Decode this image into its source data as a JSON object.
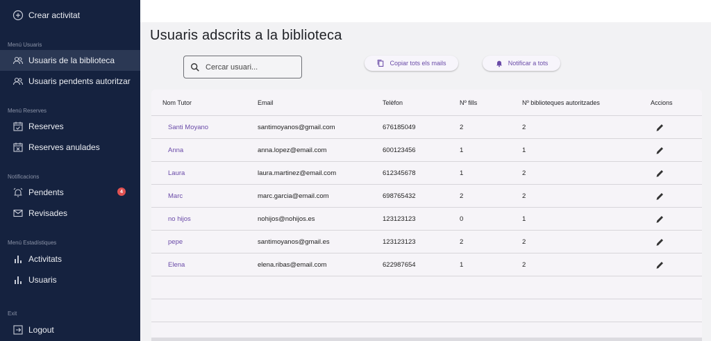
{
  "sidebar": {
    "create": "Crear activitat",
    "sections": {
      "users": "Menú Usuaris",
      "bookings": "Menú Reserves",
      "notifications": "Notificacions",
      "stats": "Menú Estadístiques",
      "exit": "Exit"
    },
    "items": {
      "library_users": "Usuaris de la biblioteca",
      "pending_users": "Usuaris pendents autoritzar",
      "bookings": "Reserves",
      "cancelled_bookings": "Reserves anulades",
      "pending": "Pendents",
      "pending_badge": "4",
      "reviewed": "Revisades",
      "activities": "Activitats",
      "stats_users": "Usuaris",
      "logout": "Logout"
    }
  },
  "main": {
    "title": "Usuaris adscrits a la biblioteca",
    "search_placeholder": "Cercar usuari...",
    "copy_button": "Copiar tots els mails",
    "notify_button": "Notificar a tots"
  },
  "table": {
    "headers": {
      "tutor": "Nom Tutor",
      "email": "Email",
      "phone": "Telèfon",
      "children": "Nº fills",
      "libraries": "Nº biblioteques autoritzades",
      "actions": "Accions"
    },
    "rows": [
      {
        "tutor": "Santi Moyano",
        "email": "santimoyanos@gmail.com",
        "phone": "676185049",
        "children": "2",
        "libraries": "2"
      },
      {
        "tutor": "Anna",
        "email": "anna.lopez@email.com",
        "phone": "600123456",
        "children": "1",
        "libraries": "1"
      },
      {
        "tutor": "Laura",
        "email": "laura.martinez@email.com",
        "phone": "612345678",
        "children": "1",
        "libraries": "2"
      },
      {
        "tutor": "Marc",
        "email": "marc.garcia@email.com",
        "phone": "698765432",
        "children": "2",
        "libraries": "2"
      },
      {
        "tutor": "no hijos",
        "email": "nohijos@nohijos.es",
        "phone": "123123123",
        "children": "0",
        "libraries": "1"
      },
      {
        "tutor": "pepe",
        "email": "santimoyanos@gmail.es",
        "phone": "123123123",
        "children": "2",
        "libraries": "2"
      },
      {
        "tutor": "Elena",
        "email": "elena.ribas@email.com",
        "phone": "622987654",
        "children": "1",
        "libraries": "2"
      }
    ]
  }
}
